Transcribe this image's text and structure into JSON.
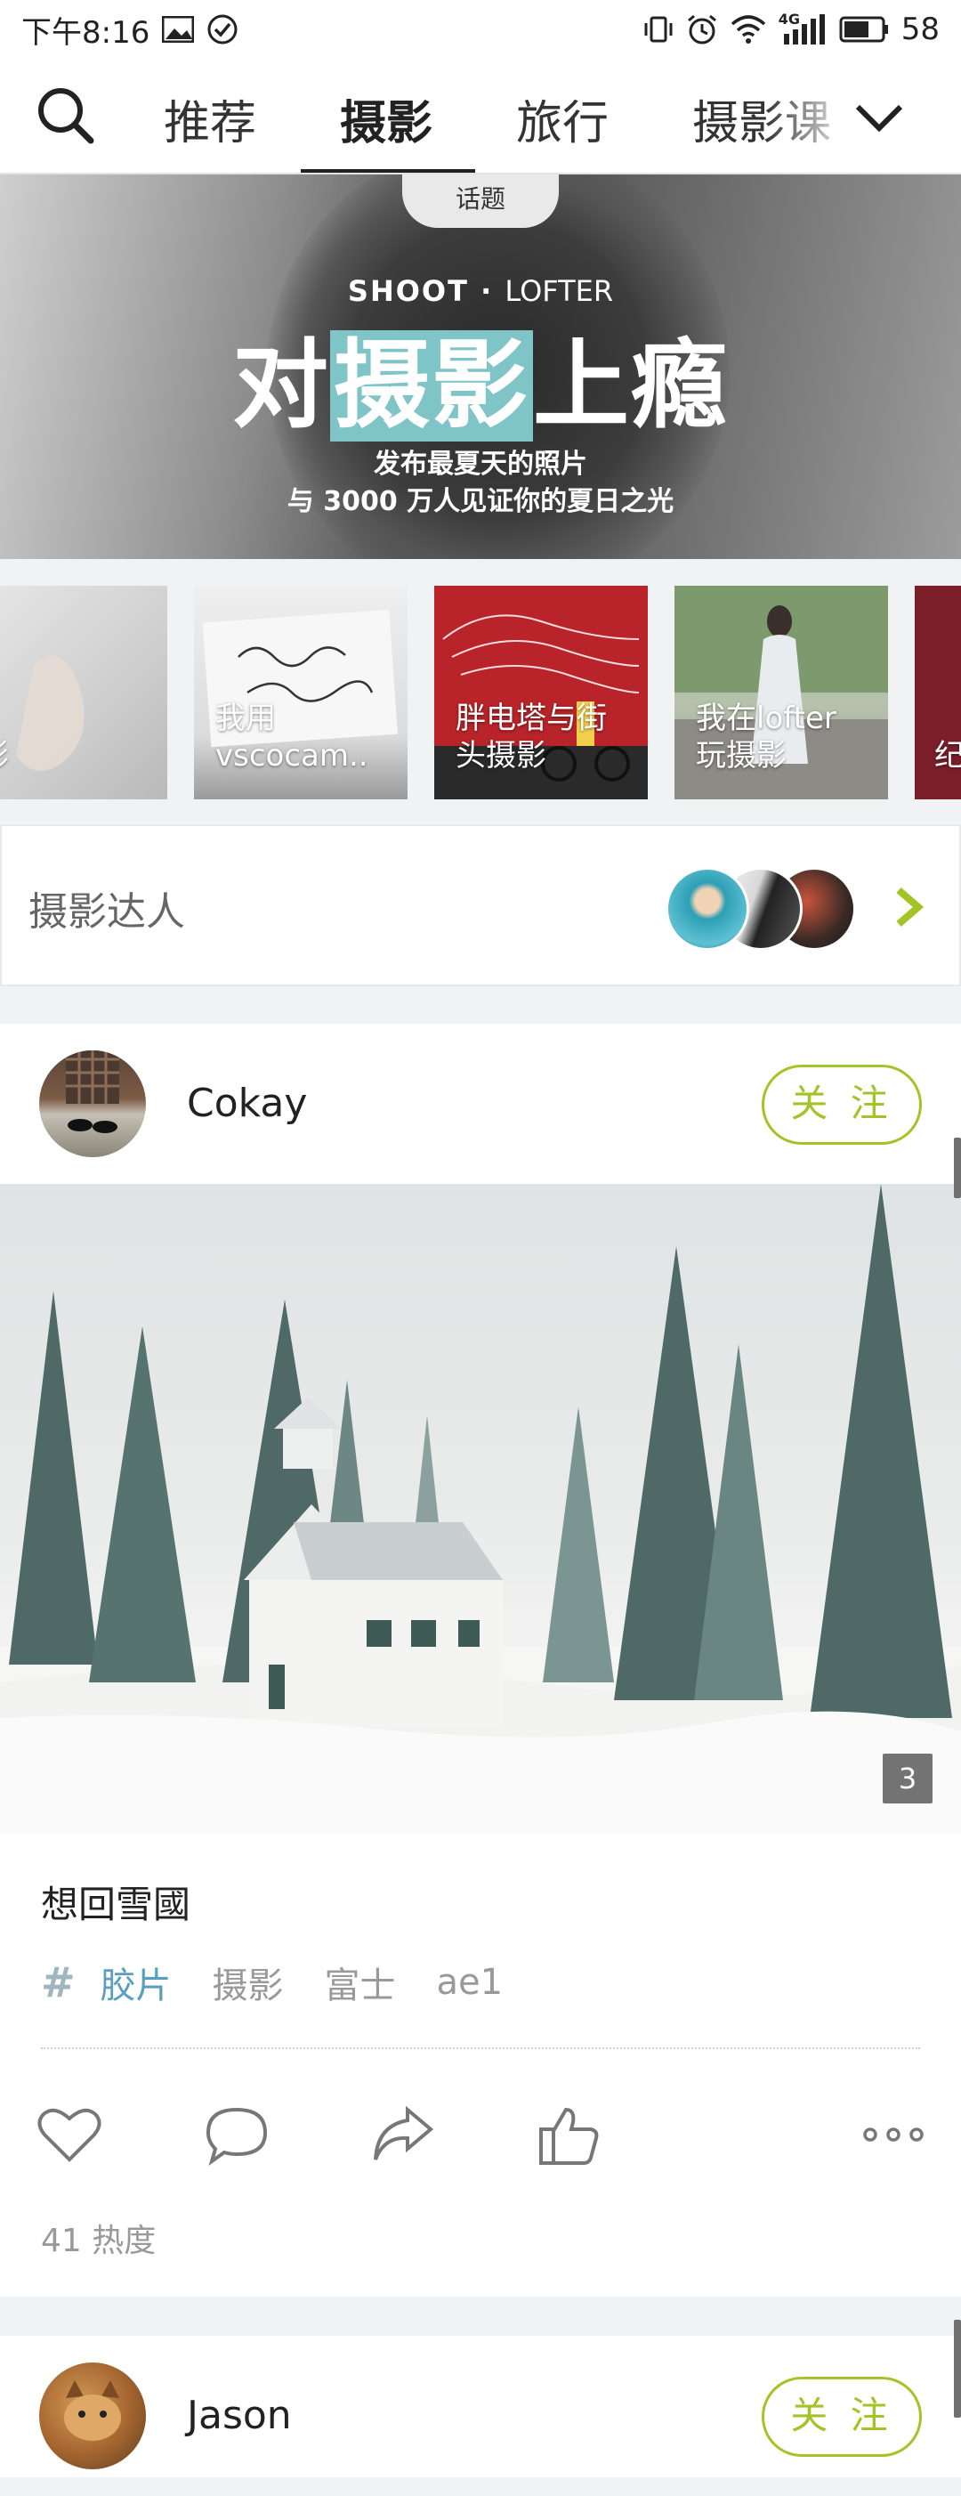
{
  "status_bar": {
    "time": "下午8:16",
    "network": "4G",
    "battery": "58"
  },
  "nav": {
    "tabs": [
      {
        "label": "推荐",
        "active": false
      },
      {
        "label": "摄影",
        "active": true
      },
      {
        "label": "旅行",
        "active": false
      },
      {
        "label": "摄影课",
        "active": false
      }
    ]
  },
  "banner": {
    "badge": "话题",
    "brand_left": "SHOOT",
    "brand_right": "LOFTER",
    "headline_part1": "对",
    "headline_highlight": "摄影",
    "headline_part2": "上瘾",
    "sub1": "发布最夏天的照片",
    "sub2": "与 3000 万人见证你的夏日之光",
    "accent_color": "#7fc4c6"
  },
  "topics": [
    {
      "label": "光影"
    },
    {
      "label": "我用\nvscocam.."
    },
    {
      "label": "胖电塔与街\n头摄影"
    },
    {
      "label": "我在lofter\n玩摄影"
    },
    {
      "label": "纪"
    }
  ],
  "experts": {
    "label": "摄影达人",
    "arrow_color": "#a3c427"
  },
  "post1": {
    "user": "Cokay",
    "follow_label": "关 注",
    "photo_count": "3",
    "title": "想回雪國",
    "tags": [
      "胶片",
      "摄影",
      "富士",
      "ae1"
    ],
    "heat": "41 热度"
  },
  "post2": {
    "user": "Jason",
    "follow_label": "关 注"
  },
  "colors": {
    "follow_green": "#a3c427",
    "tag_blue": "#5a9ec0"
  }
}
